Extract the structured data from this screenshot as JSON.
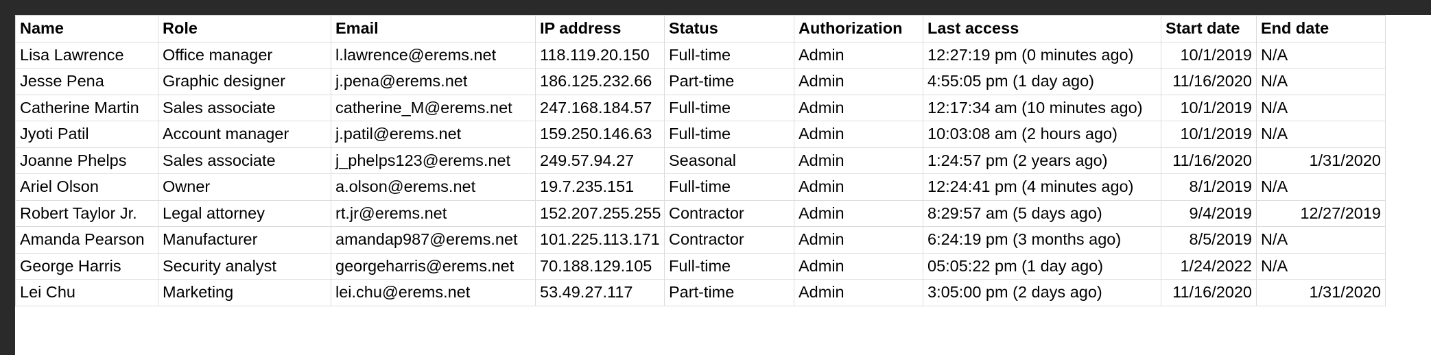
{
  "sheet": {
    "columns": [
      {
        "key": "name",
        "label": "Name",
        "width": 208
      },
      {
        "key": "role",
        "label": "Role",
        "width": 252
      },
      {
        "key": "email",
        "label": "Email",
        "width": 298
      },
      {
        "key": "ip",
        "label": "IP address",
        "width": 188
      },
      {
        "key": "status",
        "label": "Status",
        "width": 189
      },
      {
        "key": "auth",
        "label": "Authorization",
        "width": 188
      },
      {
        "key": "last",
        "label": "Last access",
        "width": 347
      },
      {
        "key": "start",
        "label": "Start date",
        "width": 139
      },
      {
        "key": "end",
        "label": "End date",
        "width": 188
      }
    ],
    "rows": [
      [
        "Lisa Lawrence",
        "Office manager",
        "l.lawrence@erems.net",
        "118.119.20.150",
        "Full-time",
        "Admin",
        "12:27:19 pm (0 minutes ago)",
        "10/1/2019",
        "N/A"
      ],
      [
        "Jesse Pena",
        "Graphic designer",
        "j.pena@erems.net",
        "186.125.232.66",
        "Part-time",
        "Admin",
        "4:55:05 pm (1 day ago)",
        "11/16/2020",
        "N/A"
      ],
      [
        "Catherine Martin",
        "Sales associate",
        "catherine_M@erems.net",
        "247.168.184.57",
        "Full-time",
        "Admin",
        "12:17:34 am (10 minutes ago)",
        "10/1/2019",
        "N/A"
      ],
      [
        "Jyoti Patil",
        "Account manager",
        "j.patil@erems.net",
        "159.250.146.63",
        "Full-time",
        "Admin",
        "10:03:08 am (2 hours ago)",
        "10/1/2019",
        "N/A"
      ],
      [
        "Joanne Phelps",
        "Sales associate",
        "j_phelps123@erems.net",
        "249.57.94.27",
        "Seasonal",
        "Admin",
        "1:24:57 pm (2 years ago)",
        "11/16/2020",
        "1/31/2020"
      ],
      [
        "Ariel Olson",
        "Owner",
        "a.olson@erems.net",
        "19.7.235.151",
        "Full-time",
        "Admin",
        "12:24:41 pm (4 minutes ago)",
        "8/1/2019",
        "N/A"
      ],
      [
        "Robert Taylor Jr.",
        "Legal attorney",
        "rt.jr@erems.net",
        "152.207.255.255",
        "Contractor",
        "Admin",
        "8:29:57 am (5 days ago)",
        "9/4/2019",
        "12/27/2019"
      ],
      [
        "Amanda Pearson",
        "Manufacturer",
        "amandap987@erems.net",
        "101.225.113.171",
        "Contractor",
        "Admin",
        "6:24:19 pm (3 months ago)",
        "8/5/2019",
        "N/A"
      ],
      [
        "George Harris",
        "Security analyst",
        "georgeharris@erems.net",
        "70.188.129.105",
        "Full-time",
        "Admin",
        "05:05:22 pm (1 day ago)",
        "1/24/2022",
        "N/A"
      ],
      [
        "Lei Chu",
        "Marketing",
        "lei.chu@erems.net",
        "53.49.27.117",
        "Part-time",
        "Admin",
        "3:05:00 pm (2 days ago)",
        "11/16/2020",
        "1/31/2020"
      ]
    ]
  }
}
